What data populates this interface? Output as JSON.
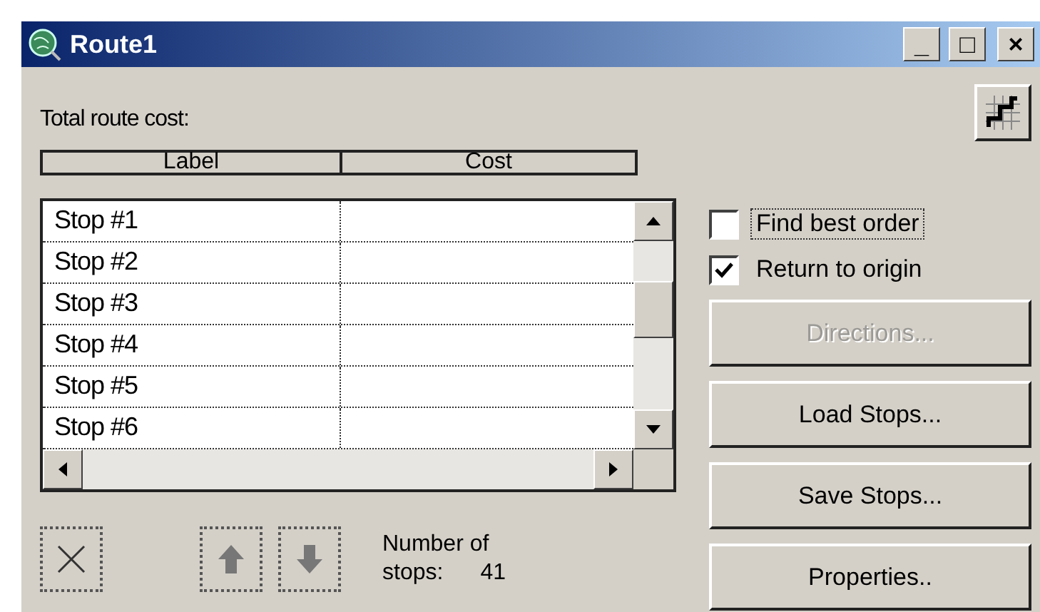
{
  "window": {
    "title": "Route1",
    "controls": [
      "_",
      "□",
      "×"
    ]
  },
  "total_route_cost": {
    "label": "Total route cost:"
  },
  "table": {
    "columns": [
      "Label",
      "Cost"
    ],
    "rows": [
      {
        "label": "Stop #1"
      },
      {
        "label": "Stop #2"
      },
      {
        "label": "Stop #3"
      },
      {
        "label": "Stop #4"
      },
      {
        "label": "Stop #5"
      },
      {
        "label": "Stop #6"
      }
    ]
  },
  "options": [
    {
      "label": "Find best order",
      "checked": false,
      "focused": true
    },
    {
      "label": "Return to origin",
      "checked": true,
      "focused": false
    }
  ],
  "buttons": [
    {
      "label": "Directions...",
      "disabled": true
    },
    {
      "label": "Load Stops...",
      "disabled": false
    },
    {
      "label": "Save Stops...",
      "disabled": false
    },
    {
      "label": "Properties..",
      "disabled": false
    }
  ],
  "stop_count": {
    "label": "Number of\nstops:",
    "value": "41"
  }
}
